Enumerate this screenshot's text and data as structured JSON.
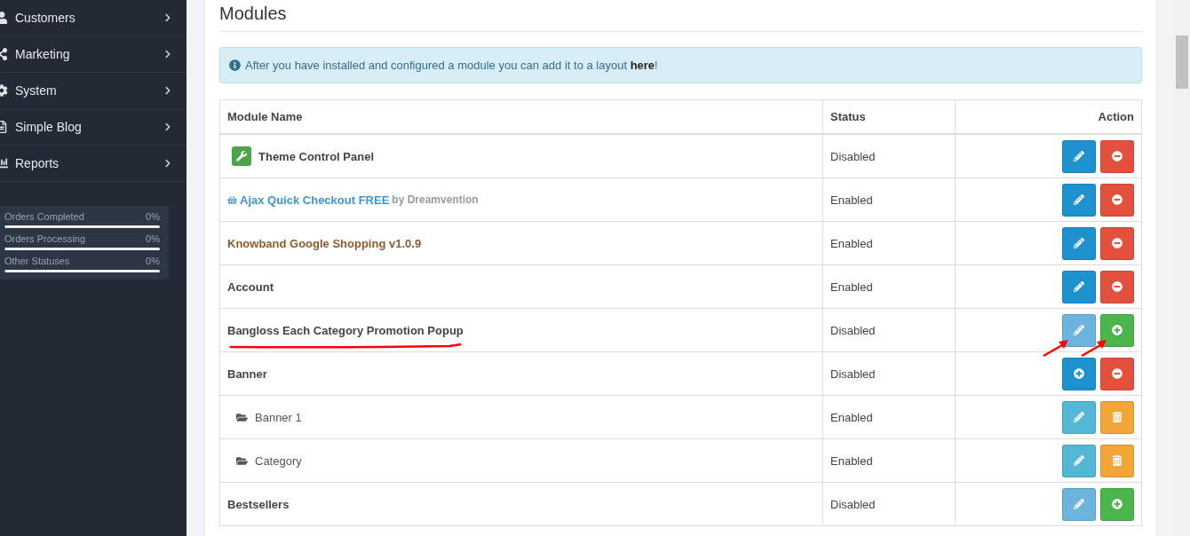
{
  "sidebar": {
    "items": [
      {
        "label": "Customers"
      },
      {
        "label": "Marketing"
      },
      {
        "label": "System"
      },
      {
        "label": "Simple Blog"
      },
      {
        "label": "Reports"
      }
    ],
    "stats": [
      {
        "label": "Orders Completed",
        "value": "0%",
        "level": 0
      },
      {
        "label": "Orders Processing",
        "value": "0%",
        "level": 0
      },
      {
        "label": "Other Statuses",
        "value": "0%",
        "level": 0
      }
    ]
  },
  "page": {
    "title": "Modules",
    "alert": {
      "text": "After you have installed and configured a module you can add it to a layout ",
      "link": "here",
      "end": "!"
    },
    "table": {
      "columns": [
        "Module Name",
        "Status",
        "Action"
      ],
      "rows": [
        {
          "kind": "plugin",
          "name": "Theme Control Panel",
          "status": "Disabled",
          "marked": false,
          "buttons": [
            {
              "kind": "edit",
              "color": "#1e91cf",
              "marked": false
            },
            {
              "kind": "uninstall",
              "color": "#e3503e",
              "marked": false
            }
          ]
        },
        {
          "kind": "link",
          "name": "Ajax Quick Checkout FREE",
          "by": "by Dreamvention",
          "status": "Enabled",
          "marked": false,
          "buttons": [
            {
              "kind": "edit",
              "color": "#1e91cf",
              "marked": false
            },
            {
              "kind": "uninstall",
              "color": "#e3503e",
              "marked": false
            }
          ]
        },
        {
          "kind": "brown",
          "name": "Knowband Google Shopping v1.0.9",
          "status": "Enabled",
          "marked": false,
          "buttons": [
            {
              "kind": "edit",
              "color": "#1e91cf",
              "marked": false
            },
            {
              "kind": "uninstall",
              "color": "#e3503e",
              "marked": false
            }
          ]
        },
        {
          "kind": "module",
          "name": "Account",
          "status": "Enabled",
          "marked": false,
          "buttons": [
            {
              "kind": "edit",
              "color": "#1e91cf",
              "marked": false
            },
            {
              "kind": "uninstall",
              "color": "#e3503e",
              "marked": false
            }
          ]
        },
        {
          "kind": "module",
          "name": "Bangloss Each Category Promotion Popup",
          "status": "Disabled",
          "marked": true,
          "buttons": [
            {
              "kind": "edit",
              "color": "#6cb3de",
              "marked": true
            },
            {
              "kind": "install",
              "color": "#4cb64c",
              "marked": true
            }
          ]
        },
        {
          "kind": "module",
          "name": "Banner",
          "status": "Disabled",
          "marked": false,
          "buttons": [
            {
              "kind": "install",
              "color": "#1e91cf",
              "marked": false
            },
            {
              "kind": "uninstall",
              "color": "#e3503e",
              "marked": false
            }
          ]
        },
        {
          "kind": "child",
          "name": "Banner 1",
          "status": "Enabled",
          "marked": false,
          "buttons": [
            {
              "kind": "edit",
              "color": "#55b7d6",
              "marked": false
            },
            {
              "kind": "delete",
              "color": "#f3a638",
              "marked": false
            }
          ]
        },
        {
          "kind": "child",
          "name": "Category",
          "status": "Enabled",
          "marked": false,
          "buttons": [
            {
              "kind": "edit",
              "color": "#55b7d6",
              "marked": false
            },
            {
              "kind": "delete",
              "color": "#f3a638",
              "marked": false
            }
          ]
        },
        {
          "kind": "module",
          "name": "Bestsellers",
          "status": "Disabled",
          "marked": false,
          "buttons": [
            {
              "kind": "edit",
              "color": "#6cb3de",
              "marked": false
            },
            {
              "kind": "install",
              "color": "#4cb64c",
              "marked": false
            }
          ]
        }
      ]
    }
  }
}
